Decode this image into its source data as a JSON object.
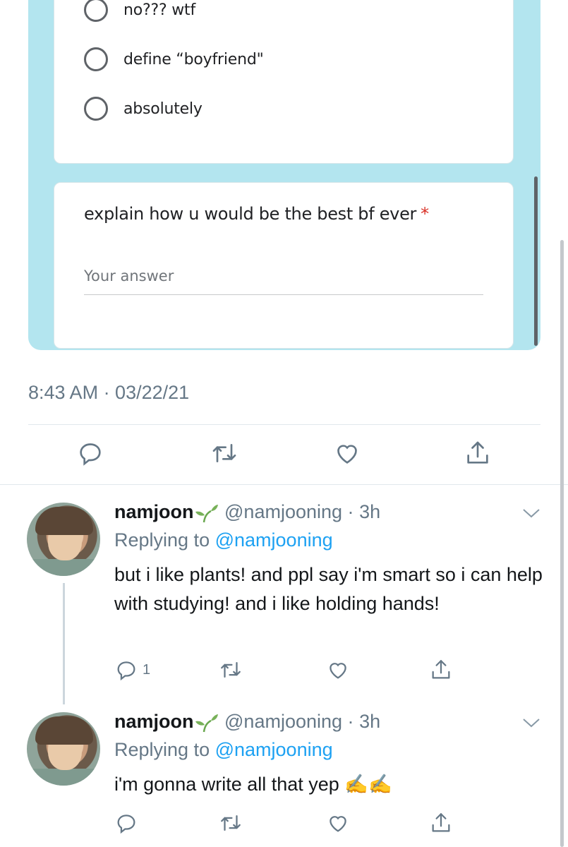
{
  "form": {
    "options": [
      "no??? wtf",
      "define “boyfriend\"",
      "absolutely"
    ],
    "question": "explain how u would be the best bf ever",
    "required_mark": "*",
    "answer_placeholder": "Your answer"
  },
  "main_tweet": {
    "timestamp": "8:43 AM · 03/22/21"
  },
  "replies": [
    {
      "name": "namjoon",
      "handle": "@namjooning",
      "dot": "·",
      "time": "3h",
      "replying_prefix": "Replying to",
      "replying_to": "@namjooning",
      "text": "but i like plants! and ppl say i'm smart so i can help with studying! and i like holding hands!",
      "reply_count": "1"
    },
    {
      "name": "namjoon",
      "handle": "@namjooning",
      "dot": "·",
      "time": "3h",
      "replying_prefix": "Replying to",
      "replying_to": "@namjooning",
      "text": "i'm gonna write all that yep ✍️✍️",
      "reply_count": ""
    }
  ],
  "icons": {
    "reply": "reply-icon",
    "retweet": "retweet-icon",
    "like": "heart-icon",
    "share": "share-icon",
    "more": "chevron-down-icon",
    "emoji": "sprout-icon"
  },
  "colors": {
    "form_background": "#b3e5ef",
    "link": "#1da1f2",
    "muted": "#657786",
    "icon": "#657786",
    "required": "#d93025"
  }
}
